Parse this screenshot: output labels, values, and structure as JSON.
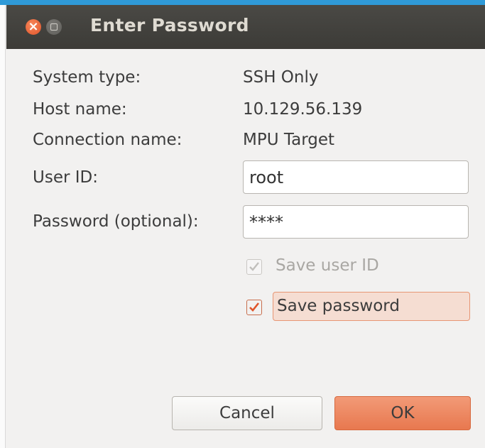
{
  "window": {
    "title": "Enter Password"
  },
  "info": {
    "system_type_label": "System type:",
    "system_type_value": "SSH Only",
    "host_name_label": "Host name:",
    "host_name_value": "10.129.56.139",
    "connection_name_label": "Connection name:",
    "connection_name_value": "MPU Target"
  },
  "form": {
    "user_id_label": "User ID:",
    "user_id_value": "root",
    "password_label": "Password (optional):",
    "password_value": "****"
  },
  "options": {
    "save_user_id_label": "Save user ID",
    "save_user_id_checked": true,
    "save_user_id_enabled": false,
    "save_password_label": "Save password",
    "save_password_checked": true
  },
  "buttons": {
    "cancel_label": "Cancel",
    "ok_label": "OK"
  },
  "colors": {
    "accent": "#e8784f",
    "titlebar": "#3c3b37",
    "top_accent": "#2f9ad8"
  }
}
